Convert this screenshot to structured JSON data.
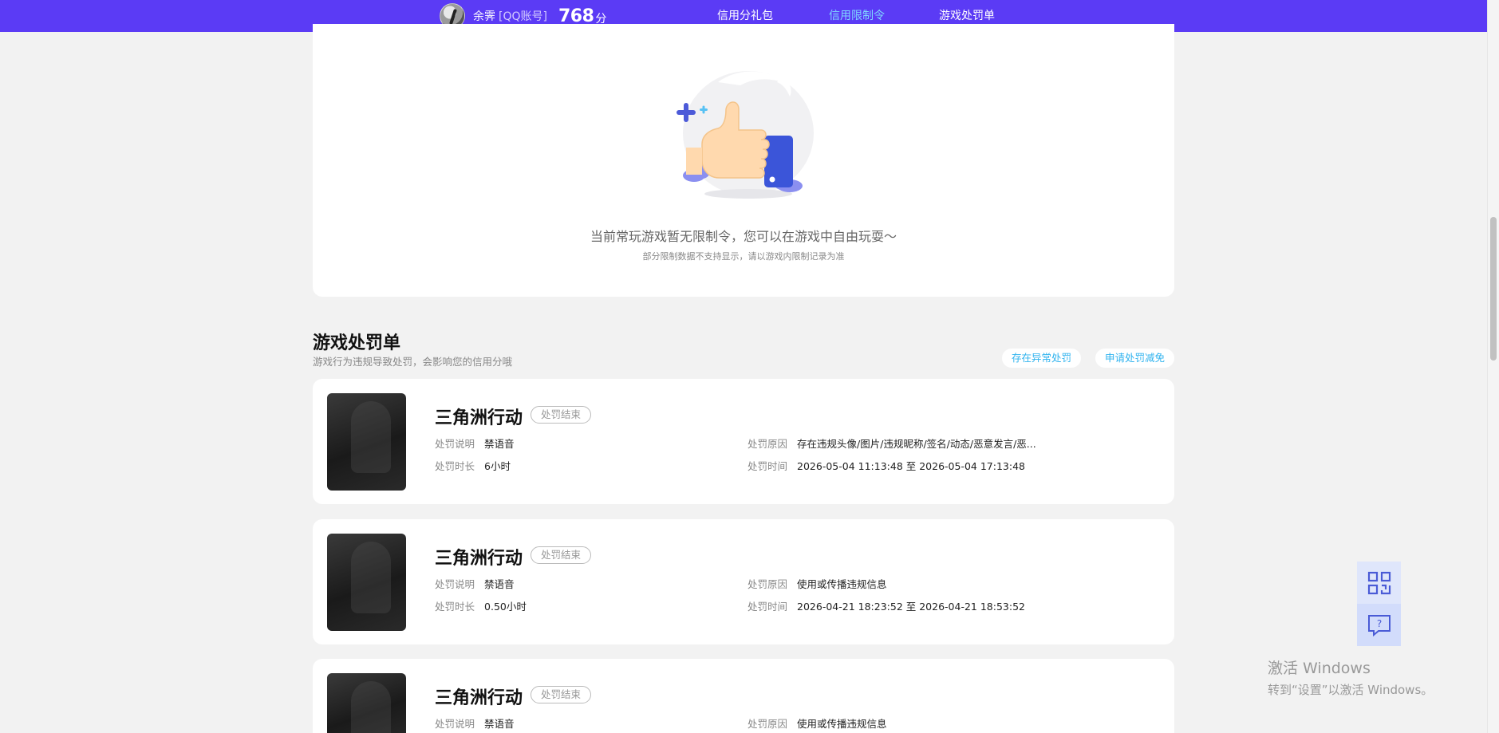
{
  "header": {
    "user_name": "余霁",
    "account_type": "[QQ账号]",
    "score": "768",
    "score_unit": "分",
    "nav": [
      {
        "label": "信用分礼包",
        "active": false
      },
      {
        "label": "信用限制令",
        "active": true
      },
      {
        "label": "游戏处罚单",
        "active": false
      }
    ]
  },
  "restriction": {
    "empty_title": "当前常玩游戏暂无限制令，您可以在游戏中自由玩耍～",
    "empty_note": "部分限制数据不支持显示，请以游戏内限制记录为准"
  },
  "penalty_section": {
    "title": "游戏处罚单",
    "subtitle": "游戏行为违规导致处罚，会影响您的信用分哦",
    "buttons": [
      "存在异常处罚",
      "申请处罚减免"
    ],
    "labels": {
      "desc": "处罚说明",
      "duration": "处罚时长",
      "reason": "处罚原因",
      "time": "处罚时间"
    },
    "items": [
      {
        "game": "三角洲行动",
        "status": "处罚结束",
        "desc": "禁语音",
        "duration": "6小时",
        "reason": "存在违规头像/图片/违规昵称/签名/动态/恶意发言/恶...",
        "time": "2026-05-04 11:13:48 至 2026-05-04 17:13:48"
      },
      {
        "game": "三角洲行动",
        "status": "处罚结束",
        "desc": "禁语音",
        "duration": "0.50小时",
        "reason": "使用或传播违规信息",
        "time": "2026-04-21 18:23:52 至 2026-04-21 18:53:52"
      },
      {
        "game": "三角洲行动",
        "status": "处罚结束",
        "desc": "禁语音",
        "duration": "",
        "reason": "使用或传播违规信息",
        "time": ""
      }
    ]
  },
  "watermark": {
    "line1": "激活 Windows",
    "line2": "转到“设置”以激活 Windows。"
  },
  "icons": {
    "qr": "qr-code-icon",
    "help": "help-chat-icon"
  },
  "colors": {
    "topbar": "#5b3bf5",
    "nav_active": "#7fd8ff",
    "accent": "#2fb3ef"
  }
}
